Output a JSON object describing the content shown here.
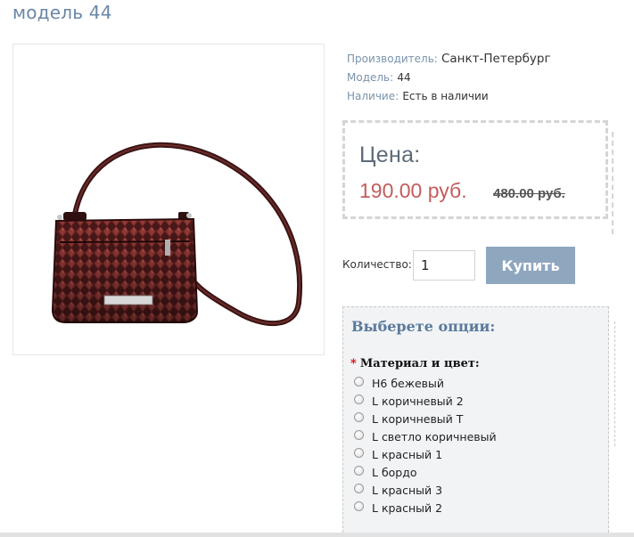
{
  "product": {
    "title": "модель 44",
    "image_alt": "Сумка"
  },
  "specs": [
    {
      "label": "Производитель:",
      "value": "Санкт-Петербург"
    },
    {
      "label": "Модель:",
      "value": "44"
    },
    {
      "label": "Наличие:",
      "value": "Есть в наличии"
    }
  ],
  "price": {
    "label": "Цена:",
    "current": "190.00 руб.",
    "old": "480.00 руб."
  },
  "purchase": {
    "quantity_label": "Количество:",
    "quantity_value": "1",
    "buy_label": "Купить"
  },
  "options": {
    "title": "Выберете опции:",
    "required_mark": "*",
    "group_label": "Материал и цвет:",
    "items": [
      "Н6 бежевый",
      "L коричневый 2",
      "L коричневый Т",
      "L светло коричневый",
      "L красный 1",
      "L бордо",
      "L красный 3",
      "L красный 2"
    ]
  },
  "colors": {
    "title": "#6a87a6",
    "price_new": "#c45c5c",
    "button": "#8fa6bf",
    "options_bg": "#f1f3f5"
  }
}
